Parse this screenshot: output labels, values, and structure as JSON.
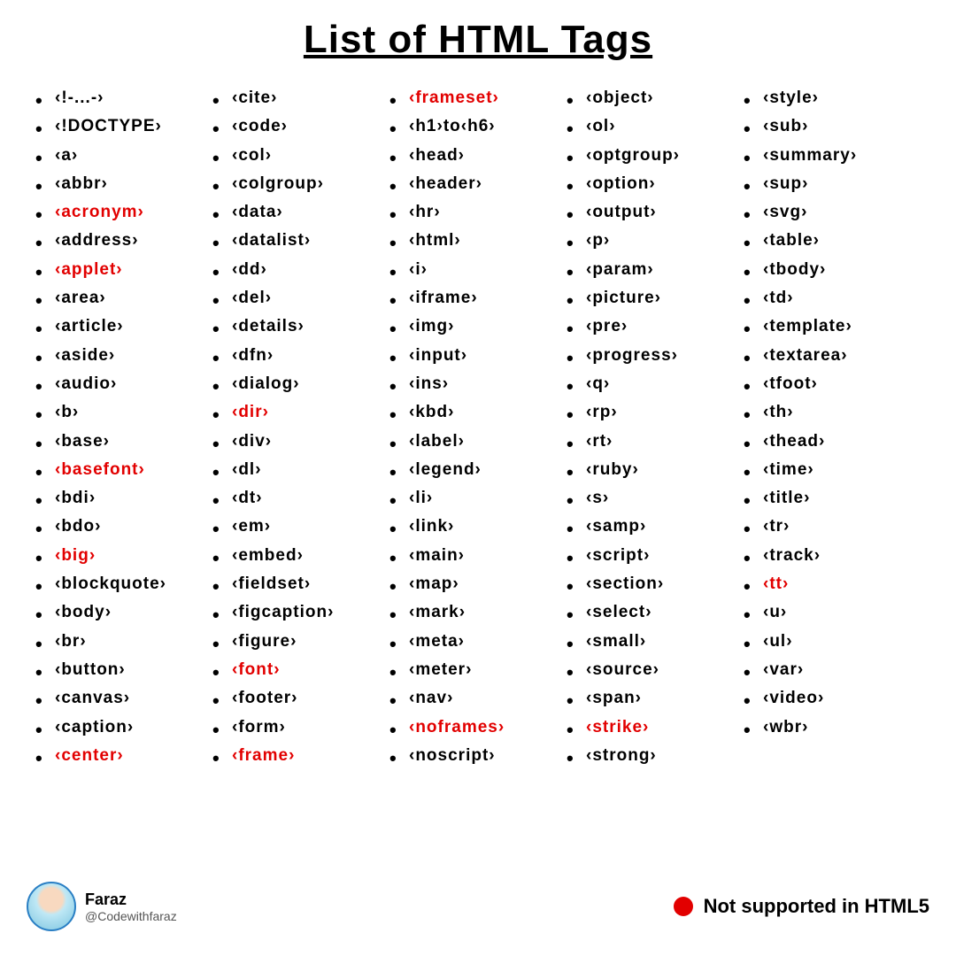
{
  "title": "List of HTML Tags",
  "columns": [
    [
      {
        "t": "<!-...->",
        "d": false
      },
      {
        "t": "<!DOCTYPE>",
        "d": false
      },
      {
        "t": "<a>",
        "d": false
      },
      {
        "t": "<abbr>",
        "d": false
      },
      {
        "t": "<acronym>",
        "d": true
      },
      {
        "t": "<address>",
        "d": false
      },
      {
        "t": "<applet>",
        "d": true
      },
      {
        "t": "<area>",
        "d": false
      },
      {
        "t": "<article>",
        "d": false
      },
      {
        "t": "<aside>",
        "d": false
      },
      {
        "t": "<audio>",
        "d": false
      },
      {
        "t": "<b>",
        "d": false
      },
      {
        "t": "<base>",
        "d": false
      },
      {
        "t": "<basefont>",
        "d": true
      },
      {
        "t": "<bdi>",
        "d": false
      },
      {
        "t": "<bdo>",
        "d": false
      },
      {
        "t": "<big>",
        "d": true
      },
      {
        "t": "<blockquote>",
        "d": false
      },
      {
        "t": "<body>",
        "d": false
      },
      {
        "t": "<br>",
        "d": false
      },
      {
        "t": "<button>",
        "d": false
      },
      {
        "t": "<canvas>",
        "d": false
      },
      {
        "t": "<caption>",
        "d": false
      },
      {
        "t": "<center>",
        "d": true
      }
    ],
    [
      {
        "t": "<cite>",
        "d": false
      },
      {
        "t": "<code>",
        "d": false
      },
      {
        "t": "<col>",
        "d": false
      },
      {
        "t": "<colgroup>",
        "d": false
      },
      {
        "t": "<data>",
        "d": false
      },
      {
        "t": "<datalist>",
        "d": false
      },
      {
        "t": "<dd>",
        "d": false
      },
      {
        "t": "<del>",
        "d": false
      },
      {
        "t": "<details>",
        "d": false
      },
      {
        "t": "<dfn>",
        "d": false
      },
      {
        "t": "<dialog>",
        "d": false
      },
      {
        "t": "<dir>",
        "d": true
      },
      {
        "t": "<div>",
        "d": false
      },
      {
        "t": "<dl>",
        "d": false
      },
      {
        "t": "<dt>",
        "d": false
      },
      {
        "t": "<em>",
        "d": false
      },
      {
        "t": "<embed>",
        "d": false
      },
      {
        "t": "<fieldset>",
        "d": false
      },
      {
        "t": "<figcaption>",
        "d": false
      },
      {
        "t": "<figure>",
        "d": false
      },
      {
        "t": "<font>",
        "d": true
      },
      {
        "t": "<footer>",
        "d": false
      },
      {
        "t": "<form>",
        "d": false
      },
      {
        "t": "<frame>",
        "d": true
      }
    ],
    [
      {
        "t": "<frameset>",
        "d": true
      },
      {
        "t": "<h1>to<h6>",
        "d": false
      },
      {
        "t": "<head>",
        "d": false
      },
      {
        "t": "<header>",
        "d": false
      },
      {
        "t": "<hr>",
        "d": false
      },
      {
        "t": "<html>",
        "d": false
      },
      {
        "t": "<i>",
        "d": false
      },
      {
        "t": "<iframe>",
        "d": false
      },
      {
        "t": "<img>",
        "d": false
      },
      {
        "t": "<input>",
        "d": false
      },
      {
        "t": "<ins>",
        "d": false
      },
      {
        "t": "<kbd>",
        "d": false
      },
      {
        "t": "<label>",
        "d": false
      },
      {
        "t": "<legend>",
        "d": false
      },
      {
        "t": "<li>",
        "d": false
      },
      {
        "t": "<link>",
        "d": false
      },
      {
        "t": "<main>",
        "d": false
      },
      {
        "t": "<map>",
        "d": false
      },
      {
        "t": "<mark>",
        "d": false
      },
      {
        "t": "<meta>",
        "d": false
      },
      {
        "t": "<meter>",
        "d": false
      },
      {
        "t": "<nav>",
        "d": false
      },
      {
        "t": "<noframes>",
        "d": true
      },
      {
        "t": "<noscript>",
        "d": false
      }
    ],
    [
      {
        "t": "<object>",
        "d": false
      },
      {
        "t": "<ol>",
        "d": false
      },
      {
        "t": "<optgroup>",
        "d": false
      },
      {
        "t": "<option>",
        "d": false
      },
      {
        "t": "<output>",
        "d": false
      },
      {
        "t": "<p>",
        "d": false
      },
      {
        "t": "<param>",
        "d": false
      },
      {
        "t": "<picture>",
        "d": false
      },
      {
        "t": "<pre>",
        "d": false
      },
      {
        "t": "<progress>",
        "d": false
      },
      {
        "t": "<q>",
        "d": false
      },
      {
        "t": "<rp>",
        "d": false
      },
      {
        "t": "<rt>",
        "d": false
      },
      {
        "t": "<ruby>",
        "d": false
      },
      {
        "t": "<s>",
        "d": false
      },
      {
        "t": "<samp>",
        "d": false
      },
      {
        "t": "<script>",
        "d": false
      },
      {
        "t": "<section>",
        "d": false
      },
      {
        "t": "<select>",
        "d": false
      },
      {
        "t": "<small>",
        "d": false
      },
      {
        "t": "<source>",
        "d": false
      },
      {
        "t": "<span>",
        "d": false
      },
      {
        "t": "<strike>",
        "d": true
      },
      {
        "t": "<strong>",
        "d": false
      }
    ],
    [
      {
        "t": "<style>",
        "d": false
      },
      {
        "t": "<sub>",
        "d": false
      },
      {
        "t": "<summary>",
        "d": false
      },
      {
        "t": "<sup>",
        "d": false
      },
      {
        "t": "<svg>",
        "d": false
      },
      {
        "t": "<table>",
        "d": false
      },
      {
        "t": "<tbody>",
        "d": false
      },
      {
        "t": "<td>",
        "d": false
      },
      {
        "t": "<template>",
        "d": false
      },
      {
        "t": "<textarea>",
        "d": false
      },
      {
        "t": "<tfoot>",
        "d": false
      },
      {
        "t": "<th>",
        "d": false
      },
      {
        "t": "<thead>",
        "d": false
      },
      {
        "t": "<time>",
        "d": false
      },
      {
        "t": "<title>",
        "d": false
      },
      {
        "t": "<tr>",
        "d": false
      },
      {
        "t": "<track>",
        "d": false
      },
      {
        "t": "<tt>",
        "d": true
      },
      {
        "t": "<u>",
        "d": false
      },
      {
        "t": "<ul>",
        "d": false
      },
      {
        "t": "<var>",
        "d": false
      },
      {
        "t": "<video>",
        "d": false
      },
      {
        "t": "<wbr>",
        "d": false
      }
    ]
  ],
  "author": {
    "name": "Faraz",
    "handle": "@Codewithfaraz"
  },
  "legend": "Not supported in HTML5"
}
